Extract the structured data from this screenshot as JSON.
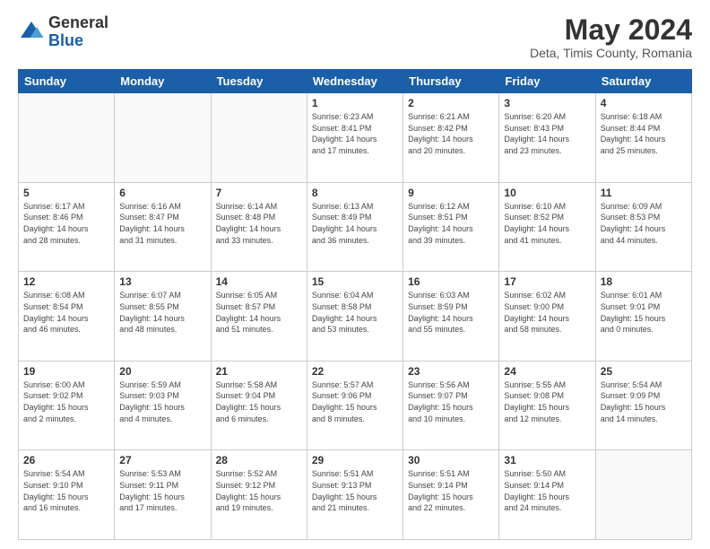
{
  "header": {
    "logo_general": "General",
    "logo_blue": "Blue",
    "month_year": "May 2024",
    "subtitle": "Deta, Timis County, Romania"
  },
  "weekdays": [
    "Sunday",
    "Monday",
    "Tuesday",
    "Wednesday",
    "Thursday",
    "Friday",
    "Saturday"
  ],
  "weeks": [
    [
      {
        "day": "",
        "info": ""
      },
      {
        "day": "",
        "info": ""
      },
      {
        "day": "",
        "info": ""
      },
      {
        "day": "1",
        "info": "Sunrise: 6:23 AM\nSunset: 8:41 PM\nDaylight: 14 hours\nand 17 minutes."
      },
      {
        "day": "2",
        "info": "Sunrise: 6:21 AM\nSunset: 8:42 PM\nDaylight: 14 hours\nand 20 minutes."
      },
      {
        "day": "3",
        "info": "Sunrise: 6:20 AM\nSunset: 8:43 PM\nDaylight: 14 hours\nand 23 minutes."
      },
      {
        "day": "4",
        "info": "Sunrise: 6:18 AM\nSunset: 8:44 PM\nDaylight: 14 hours\nand 25 minutes."
      }
    ],
    [
      {
        "day": "5",
        "info": "Sunrise: 6:17 AM\nSunset: 8:46 PM\nDaylight: 14 hours\nand 28 minutes."
      },
      {
        "day": "6",
        "info": "Sunrise: 6:16 AM\nSunset: 8:47 PM\nDaylight: 14 hours\nand 31 minutes."
      },
      {
        "day": "7",
        "info": "Sunrise: 6:14 AM\nSunset: 8:48 PM\nDaylight: 14 hours\nand 33 minutes."
      },
      {
        "day": "8",
        "info": "Sunrise: 6:13 AM\nSunset: 8:49 PM\nDaylight: 14 hours\nand 36 minutes."
      },
      {
        "day": "9",
        "info": "Sunrise: 6:12 AM\nSunset: 8:51 PM\nDaylight: 14 hours\nand 39 minutes."
      },
      {
        "day": "10",
        "info": "Sunrise: 6:10 AM\nSunset: 8:52 PM\nDaylight: 14 hours\nand 41 minutes."
      },
      {
        "day": "11",
        "info": "Sunrise: 6:09 AM\nSunset: 8:53 PM\nDaylight: 14 hours\nand 44 minutes."
      }
    ],
    [
      {
        "day": "12",
        "info": "Sunrise: 6:08 AM\nSunset: 8:54 PM\nDaylight: 14 hours\nand 46 minutes."
      },
      {
        "day": "13",
        "info": "Sunrise: 6:07 AM\nSunset: 8:55 PM\nDaylight: 14 hours\nand 48 minutes."
      },
      {
        "day": "14",
        "info": "Sunrise: 6:05 AM\nSunset: 8:57 PM\nDaylight: 14 hours\nand 51 minutes."
      },
      {
        "day": "15",
        "info": "Sunrise: 6:04 AM\nSunset: 8:58 PM\nDaylight: 14 hours\nand 53 minutes."
      },
      {
        "day": "16",
        "info": "Sunrise: 6:03 AM\nSunset: 8:59 PM\nDaylight: 14 hours\nand 55 minutes."
      },
      {
        "day": "17",
        "info": "Sunrise: 6:02 AM\nSunset: 9:00 PM\nDaylight: 14 hours\nand 58 minutes."
      },
      {
        "day": "18",
        "info": "Sunrise: 6:01 AM\nSunset: 9:01 PM\nDaylight: 15 hours\nand 0 minutes."
      }
    ],
    [
      {
        "day": "19",
        "info": "Sunrise: 6:00 AM\nSunset: 9:02 PM\nDaylight: 15 hours\nand 2 minutes."
      },
      {
        "day": "20",
        "info": "Sunrise: 5:59 AM\nSunset: 9:03 PM\nDaylight: 15 hours\nand 4 minutes."
      },
      {
        "day": "21",
        "info": "Sunrise: 5:58 AM\nSunset: 9:04 PM\nDaylight: 15 hours\nand 6 minutes."
      },
      {
        "day": "22",
        "info": "Sunrise: 5:57 AM\nSunset: 9:06 PM\nDaylight: 15 hours\nand 8 minutes."
      },
      {
        "day": "23",
        "info": "Sunrise: 5:56 AM\nSunset: 9:07 PM\nDaylight: 15 hours\nand 10 minutes."
      },
      {
        "day": "24",
        "info": "Sunrise: 5:55 AM\nSunset: 9:08 PM\nDaylight: 15 hours\nand 12 minutes."
      },
      {
        "day": "25",
        "info": "Sunrise: 5:54 AM\nSunset: 9:09 PM\nDaylight: 15 hours\nand 14 minutes."
      }
    ],
    [
      {
        "day": "26",
        "info": "Sunrise: 5:54 AM\nSunset: 9:10 PM\nDaylight: 15 hours\nand 16 minutes."
      },
      {
        "day": "27",
        "info": "Sunrise: 5:53 AM\nSunset: 9:11 PM\nDaylight: 15 hours\nand 17 minutes."
      },
      {
        "day": "28",
        "info": "Sunrise: 5:52 AM\nSunset: 9:12 PM\nDaylight: 15 hours\nand 19 minutes."
      },
      {
        "day": "29",
        "info": "Sunrise: 5:51 AM\nSunset: 9:13 PM\nDaylight: 15 hours\nand 21 minutes."
      },
      {
        "day": "30",
        "info": "Sunrise: 5:51 AM\nSunset: 9:14 PM\nDaylight: 15 hours\nand 22 minutes."
      },
      {
        "day": "31",
        "info": "Sunrise: 5:50 AM\nSunset: 9:14 PM\nDaylight: 15 hours\nand 24 minutes."
      },
      {
        "day": "",
        "info": ""
      }
    ]
  ]
}
